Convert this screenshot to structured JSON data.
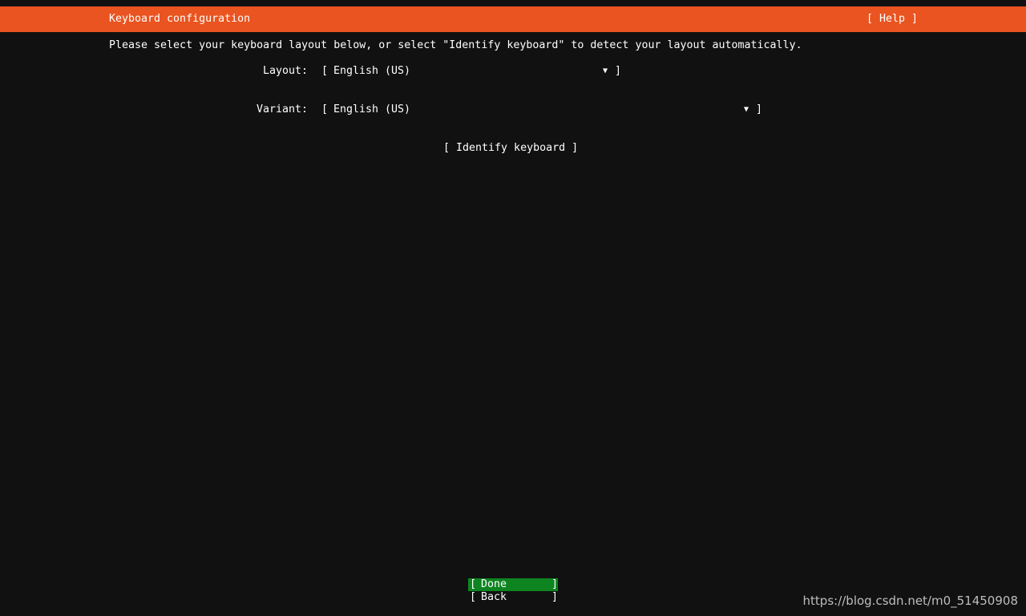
{
  "header": {
    "title": "Keyboard configuration",
    "help_label": "[ Help ]"
  },
  "instructions": "Please select your keyboard layout below, or select \"Identify keyboard\" to detect your layout automatically.",
  "layout": {
    "label": "Layout:",
    "value": "English (US)",
    "open_bracket": "[",
    "close_bracket": "]",
    "arrow": "▼"
  },
  "variant": {
    "label": "Variant:",
    "value": "English (US)",
    "open_bracket": "[",
    "close_bracket": "]",
    "arrow": "▼"
  },
  "identify_label": "[ Identify keyboard ]",
  "buttons": {
    "done_label": "Done",
    "back_label": "Back",
    "open_bracket": "[",
    "close_bracket": "]"
  },
  "colors": {
    "header": "#e95420",
    "done_highlight": "#0e8420",
    "background": "#111111"
  },
  "watermark": "https://blog.csdn.net/m0_51450908"
}
